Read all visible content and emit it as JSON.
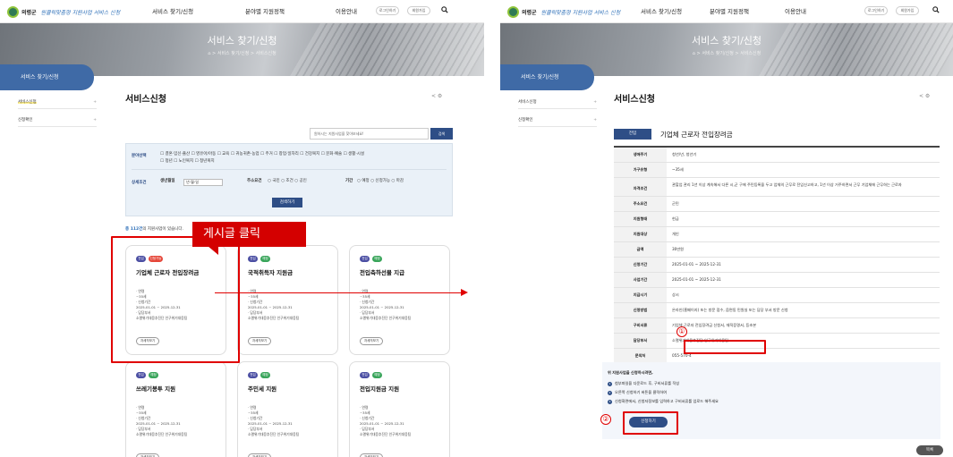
{
  "header": {
    "logo_name": "의령군",
    "logo_sub": "원클릭맞춤형 지원사업 서비스 신청",
    "nav": [
      "서비스 찾기/신청",
      "분야별 지원정책",
      "이용안내"
    ],
    "login_label": "로그인하기",
    "signup_label": "회원가입"
  },
  "hero": {
    "title": "서비스 찾기/신청",
    "breadcrumb": "⌂  >  서비스 찾기/신청  >  서비스신청"
  },
  "sidebar": {
    "title": "서비스 찾기/신청",
    "items": [
      {
        "label": "서비스신청",
        "mark": "+"
      },
      {
        "label": "신청확인",
        "mark": "+"
      }
    ]
  },
  "page_title": "서비스신청",
  "share_icons": "< ⚙",
  "search": {
    "placeholder": "원하시는 지원사업을 찾아보세요!",
    "button": "검색"
  },
  "filter": {
    "field_label": "분야선택",
    "fields_line1": "☐ 결혼·임신·출산   ☐ 영유아/아동   ☐ 교육   ☐ 귀농귀촌·농업   ☐ 주거   ☐ 창업·일자리   ☐ 건강복지   ☐ 문화·예술   ☐ 생활·시설",
    "fields_line2": "☐ 청년   ☐ 노인복지   ☐ 청년복지",
    "cond_label": "상세조건",
    "birth_label": "생년월일",
    "birth_value": "년-월-일",
    "addr_label": "주소요건",
    "addr_options": "○ 국민   ○ 조건   ○ 공인",
    "period_label": "기간",
    "period_options": "○ 예정   ○ 신청가능   ○ 마감",
    "search_button": "검색하기"
  },
  "result_count": {
    "num": "총 112건",
    "text": "의 지원사업이 있습니다."
  },
  "callout": "게시글 클릭",
  "cards": [
    {
      "badges": [
        "전입",
        "신청가능"
      ],
      "title": "기업체 근로자 전입장려금",
      "age": "~35세",
      "period": "2025-01-01 ~ 2025-12-31",
      "dept": "소멸위기대응추진단 인구위기대응팀",
      "button": "자세히보기"
    },
    {
      "badges": [
        "전입",
        "예정"
      ],
      "title": "국적취득자 지원금",
      "age": "~35세",
      "period": "2025-01-01 ~ 2025-12-31",
      "dept": "소멸위기대응추진단 인구위기대응팀",
      "button": "자세히보기"
    },
    {
      "badges": [
        "전입",
        "예정"
      ],
      "title": "전입축하선물 지급",
      "age": "~35세",
      "period": "2025-01-01 ~ 2025-12-31",
      "dept": "소멸위기대응추진단 인구위기대응팀",
      "button": "자세히보기"
    },
    {
      "badges": [
        "전입",
        "예정"
      ],
      "title": "쓰레기봉투 지원",
      "age": "~35세",
      "period": "2025-01-01 ~ 2025-12-31",
      "dept": "소멸위기대응추진단 인구위기대응팀",
      "button": "자세히보기"
    },
    {
      "badges": [
        "전입",
        "예정"
      ],
      "title": "주민세 지원",
      "age": "~35세",
      "period": "2025-01-01 ~ 2025-12-31",
      "dept": "소멸위기대응추진단 인구위기대응팀",
      "button": "자세히보기"
    },
    {
      "badges": [
        "전입",
        "예정"
      ],
      "title": "전입지원금 지원",
      "age": "~35세",
      "period": "2025-01-01 ~ 2025-12-31",
      "dept": "소멸위기대응추진단 인구위기대응팀",
      "button": "자세히보기"
    }
  ],
  "card_labels": {
    "age": "연령",
    "period": "신청기간",
    "dept": "담당부서"
  },
  "detail": {
    "tag": "전입",
    "title": "기업체 근로자 전입장려금",
    "rows": [
      {
        "k": "생애주기",
        "v": "청년/년, 청년기"
      },
      {
        "k": "가구유형",
        "v": "~35세"
      },
      {
        "k": "자격조건",
        "v": "관할업 관리 1년 이상 계속해서 다른 시,군 구에 주민등록을 두고 업체의 근무로 전입신고하고, 1년 이상 거주하면서 근무 기업체에 근무하는 근로자"
      },
      {
        "k": "주소요건",
        "v": "군민"
      },
      {
        "k": "지원형태",
        "v": "현금"
      },
      {
        "k": "지원대상",
        "v": "개인"
      },
      {
        "k": "금액",
        "v": "30만원"
      },
      {
        "k": "신청기간",
        "v": "2025-01-01 ~ 2025-12-31"
      },
      {
        "k": "사업기간",
        "v": "2025-01-01 ~ 2025-12-31"
      },
      {
        "k": "지급시기",
        "v": "상시"
      },
      {
        "k": "신청방법",
        "v": "온라인(홈페이지) 또는 방문 접수, 읍면동 민원실 또는 담당 부서 방문 신청"
      },
      {
        "k": "구비서류",
        "v": "기업체 근로자 전입장려금 신청서, 재직증명서, 등초본"
      },
      {
        "k": "담당부서",
        "v": "소멸위기대응추진단 인구위기대응팀"
      },
      {
        "k": "문의처",
        "v": "055-570-4"
      },
      {
        "k": "첨부파일",
        "v": "기업체근로자전입장려금신청서.hwp"
      }
    ],
    "notice_title": "위 지원사업을 신청하시려면,",
    "notice_steps": [
      "첨부파일을 다운로드 후, 구비서류를 작성",
      "오른쪽 신청하기 버튼을 클릭하여",
      "신청화면에서, 신청자정보를 입력하고 구비서류를 업로드 해주세요"
    ],
    "apply_button": "신청하기",
    "list_button": "목록",
    "marker1": "①",
    "marker2": "②"
  }
}
